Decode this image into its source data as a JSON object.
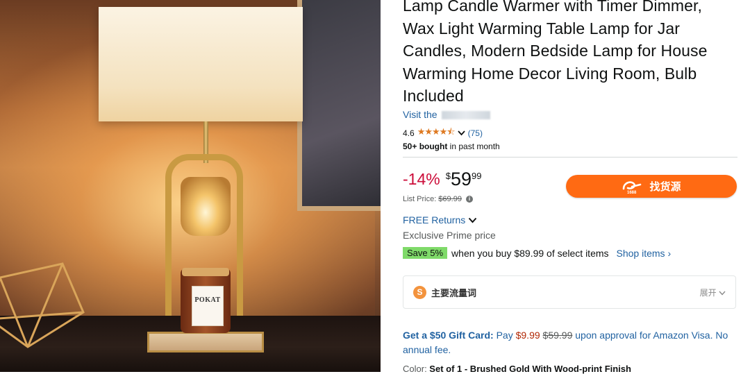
{
  "product": {
    "title": "Lamp Candle Warmer with Timer Dimmer, Wax Light Warming Table Lamp for Jar Candles, Modern Bedside Lamp for House Warming Home Decor Living Room, Bulb Included",
    "visit_store": "Visit the",
    "rating_value": "4.6",
    "stars": "★★★★⯪",
    "rating_count": "(75)",
    "bought_bold": "50+ bought",
    "bought_rest": " in past month",
    "image_label": "POKAT"
  },
  "price": {
    "discount": "-14%",
    "currency": "$",
    "whole": "59",
    "fraction": "99",
    "list_label": "List Price:",
    "list_value": "$69.99"
  },
  "plugin": {
    "button_label": "找货源",
    "button_logo": "1688"
  },
  "shipping": {
    "returns": "FREE Returns",
    "prime": "Exclusive Prime price"
  },
  "promo": {
    "badge": "Save 5%",
    "text": "when you buy $89.99 of select items",
    "link": "Shop items ›"
  },
  "keywords": {
    "icon": "S",
    "label": "主要流量词",
    "expand": "展开"
  },
  "gift": {
    "bold": "Get a $50 Gift Card:",
    "pay": " Pay ",
    "price_new": "$9.99",
    "price_old": "$59.99",
    "rest": " upon approval for Amazon Visa. No annual fee."
  },
  "variant": {
    "label": "Color: ",
    "value": "Set of 1 - Brushed Gold With Wood-print Finish"
  },
  "colors": {
    "link": "#2162a1",
    "discount": "#cc0c39",
    "star": "#de7921",
    "plugin_button": "#ff6a13",
    "save_badge": "#7fda69"
  }
}
